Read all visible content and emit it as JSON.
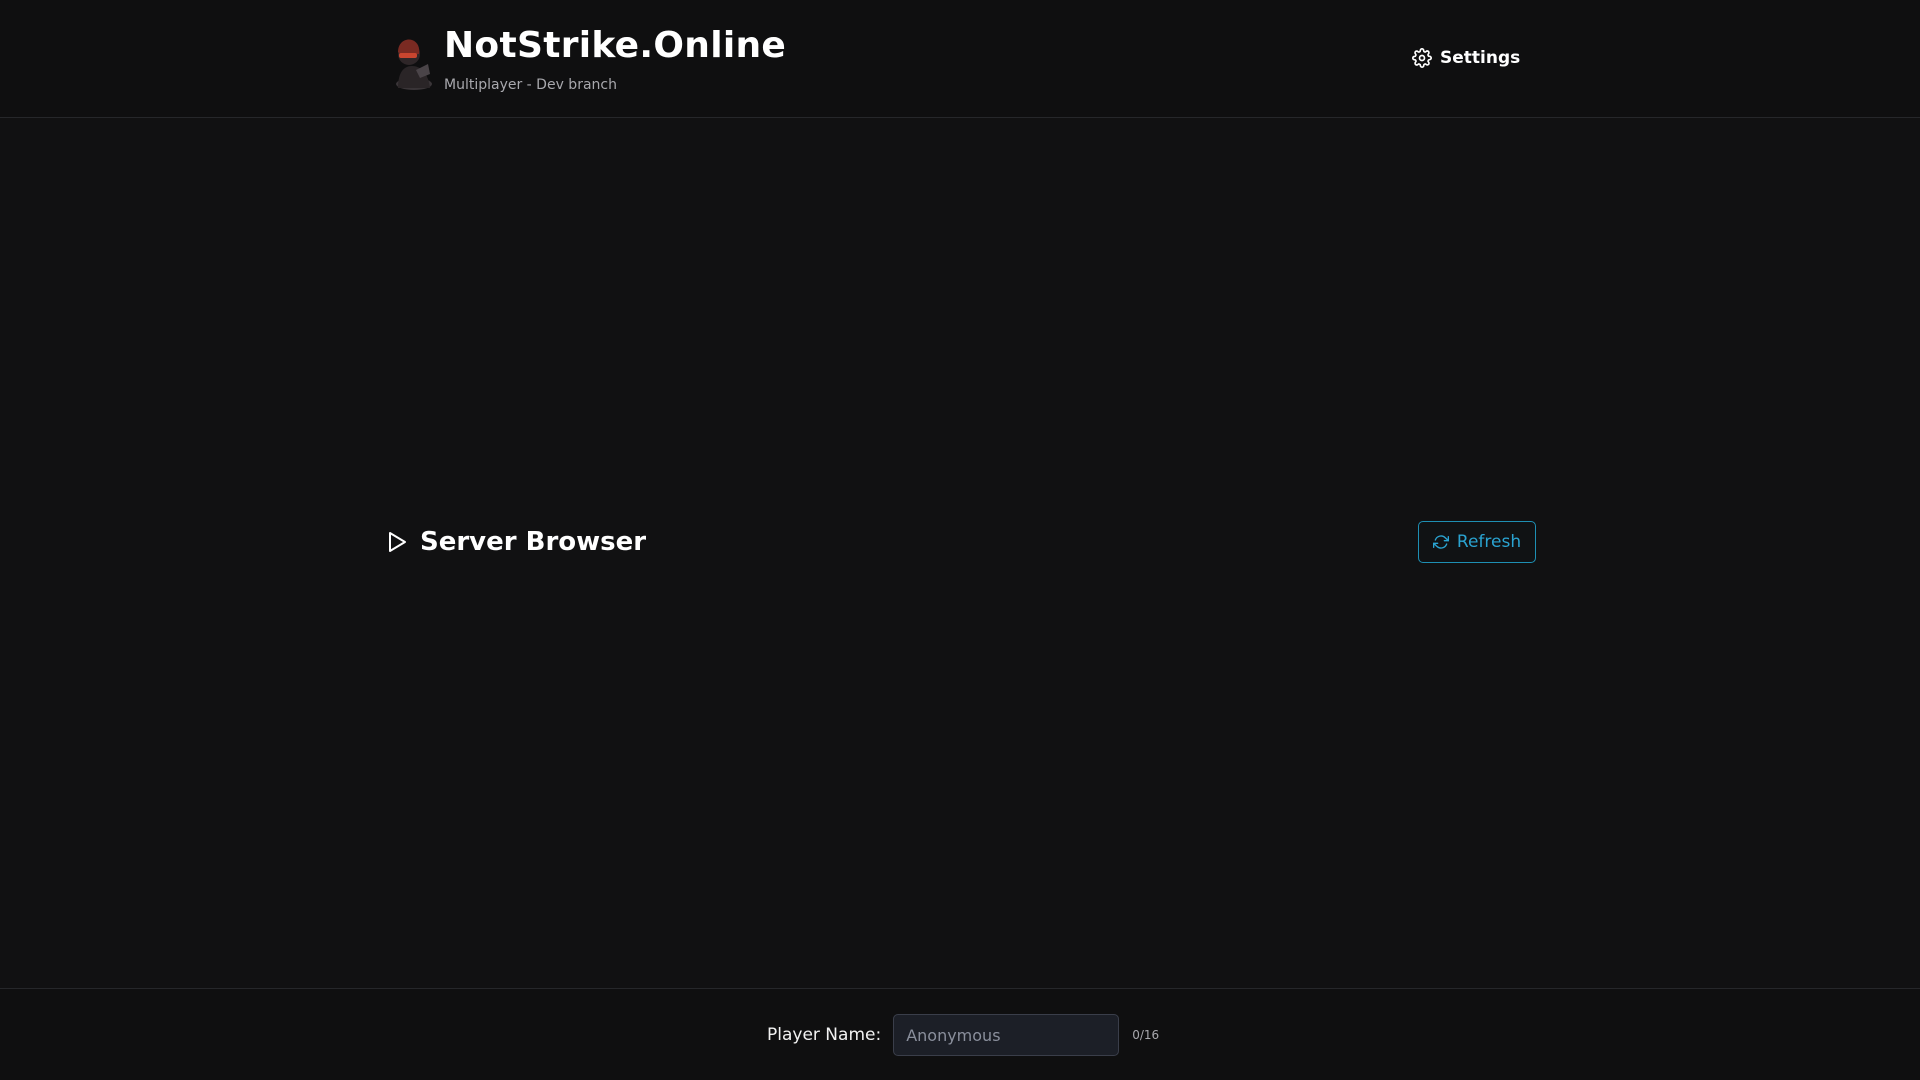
{
  "header": {
    "title": "NotStrike.Online",
    "subtitle": "Multiplayer - Dev branch",
    "logo_icon": "masked-player-avatar-icon",
    "settings_label": "Settings",
    "settings_icon": "gear-icon"
  },
  "server_browser": {
    "title": "Server Browser",
    "toggle_icon": "play-triangle-icon",
    "refresh_label": "Refresh",
    "refresh_icon": "refresh-icon"
  },
  "footer": {
    "player_name_label": "Player Name:",
    "player_name_value": "",
    "player_name_placeholder": "Anonymous",
    "char_counter": "0/16"
  },
  "colors": {
    "background": "#111112",
    "accent": "#2aa3d1",
    "text_primary": "#ffffff",
    "text_muted": "#a8a8ad"
  }
}
